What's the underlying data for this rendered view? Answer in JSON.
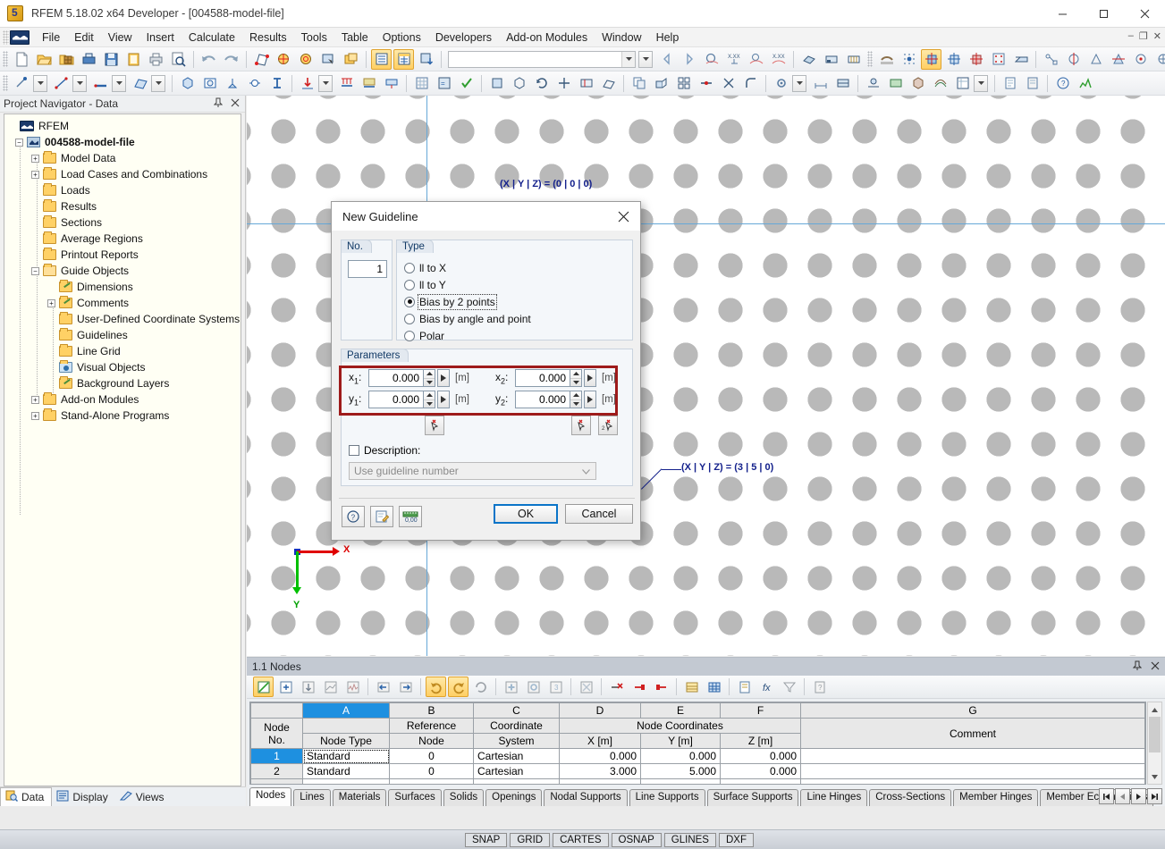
{
  "window": {
    "title": "RFEM 5.18.02 x64 Developer - [004588-model-file]",
    "minimize": "–",
    "maximize": "□",
    "close": "✕",
    "inner_minimize": "–",
    "inner_restore": "❐",
    "inner_close": "✕"
  },
  "menu": {
    "items": [
      {
        "label": "File",
        "accel": "F"
      },
      {
        "label": "Edit",
        "accel": "E"
      },
      {
        "label": "View",
        "accel": "V"
      },
      {
        "label": "Insert",
        "accel": "I"
      },
      {
        "label": "Calculate",
        "accel": "C"
      },
      {
        "label": "Results",
        "accel": "R"
      },
      {
        "label": "Tools",
        "accel": "T"
      },
      {
        "label": "Table",
        "accel": "b"
      },
      {
        "label": "Options",
        "accel": "O"
      },
      {
        "label": "Developers",
        "accel": ""
      },
      {
        "label": "Add-on Modules",
        "accel": "A"
      },
      {
        "label": "Window",
        "accel": "W"
      },
      {
        "label": "Help",
        "accel": "H"
      }
    ]
  },
  "toolbar": {
    "combo_value": "",
    "combo_placeholder": ""
  },
  "navigator": {
    "header": "Project Navigator - Data",
    "pin_icon": "pin-icon",
    "close_icon": "close-icon",
    "root": "RFEM",
    "model": "004588-model-file",
    "items": [
      {
        "label": "Model Data",
        "expander": "+",
        "indent": 1,
        "icon": "folder"
      },
      {
        "label": "Load Cases and Combinations",
        "expander": "+",
        "indent": 1,
        "icon": "folder"
      },
      {
        "label": "Loads",
        "expander": "",
        "indent": 1,
        "icon": "folder"
      },
      {
        "label": "Results",
        "expander": "",
        "indent": 1,
        "icon": "folder"
      },
      {
        "label": "Sections",
        "expander": "",
        "indent": 1,
        "icon": "folder"
      },
      {
        "label": "Average Regions",
        "expander": "",
        "indent": 1,
        "icon": "folder"
      },
      {
        "label": "Printout Reports",
        "expander": "",
        "indent": 1,
        "icon": "folder"
      },
      {
        "label": "Guide Objects",
        "expander": "-",
        "indent": 1,
        "icon": "folder-open"
      },
      {
        "label": "Dimensions",
        "expander": "",
        "indent": 2,
        "icon": "folder-pen"
      },
      {
        "label": "Comments",
        "expander": "+",
        "indent": 2,
        "icon": "folder-pen"
      },
      {
        "label": "User-Defined Coordinate Systems",
        "expander": "",
        "indent": 2,
        "icon": "folder"
      },
      {
        "label": "Guidelines",
        "expander": "",
        "indent": 2,
        "icon": "folder"
      },
      {
        "label": "Line Grid",
        "expander": "",
        "indent": 2,
        "icon": "folder"
      },
      {
        "label": "Visual Objects",
        "expander": "",
        "indent": 2,
        "icon": "folder-cam"
      },
      {
        "label": "Background Layers",
        "expander": "",
        "indent": 2,
        "icon": "folder-pen"
      },
      {
        "label": "Add-on Modules",
        "expander": "+",
        "indent": 1,
        "icon": "folder"
      },
      {
        "label": "Stand-Alone Programs",
        "expander": "+",
        "indent": 1,
        "icon": "folder"
      }
    ],
    "bottom_tabs": [
      {
        "label": "Data",
        "selected": true,
        "icon": "data-icon"
      },
      {
        "label": "Display",
        "selected": false,
        "icon": "display-icon"
      },
      {
        "label": "Views",
        "selected": false,
        "icon": "views-icon"
      }
    ]
  },
  "canvas": {
    "label_origin": "(X | Y | Z) = (0 | 0 | 0)",
    "label_point2": "(X | Y | Z) = (3 | 5 | 0)",
    "axis_x_label": "X",
    "axis_y_label": "Y"
  },
  "dialog": {
    "title": "New Guideline",
    "close_icon": "close-icon",
    "no_group": "No.",
    "no_value": "1",
    "type_group": "Type",
    "type_options": [
      {
        "label": "ll to X",
        "accel": "X",
        "selected": false
      },
      {
        "label": "ll to Y",
        "accel": "Y",
        "selected": false
      },
      {
        "label": "Bias by 2 points",
        "accel": "2",
        "selected": true
      },
      {
        "label": "Bias by angle and point",
        "accel": "a",
        "selected": false
      },
      {
        "label": "Polar",
        "accel": "P",
        "selected": false
      }
    ],
    "parameters_group": "Parameters",
    "fields": [
      {
        "name": "x1",
        "label": "x",
        "sub": "1",
        "value": "0.000",
        "unit": "[m]"
      },
      {
        "name": "x2",
        "label": "x",
        "sub": "2",
        "value": "0.000",
        "unit": "[m]"
      },
      {
        "name": "y1",
        "label": "y",
        "sub": "1",
        "value": "0.000",
        "unit": "[m]"
      },
      {
        "name": "y2",
        "label": "y",
        "sub": "2",
        "value": "0.000",
        "unit": "[m]"
      }
    ],
    "description_label": "Description:",
    "description_checked": false,
    "description_value": "Use guideline number",
    "help_icon": "help-icon",
    "edit_icon": "edit-icon",
    "units_icon": "units-icon",
    "ok_label": "OK",
    "cancel_label": "Cancel",
    "pick_icon_1": "pick-point-icon",
    "pick_icon_2": "pick-point-icon",
    "pick_icon_3": "pick-two-points-icon",
    "highlight_color": "#9e1b1b"
  },
  "table": {
    "title": "1.1 Nodes",
    "pin_icon": "pin-icon",
    "close_icon": "close-icon",
    "column_letters": [
      "",
      "A",
      "B",
      "C",
      "D",
      "E",
      "F",
      "G"
    ],
    "selected_column": "A",
    "group_header": "Node Coordinates",
    "headers": {
      "row_no_top": "Node",
      "row_no_bottom": "No.",
      "a_bottom": "Node Type",
      "b_top": "Reference",
      "b_bottom": "Node",
      "c_top": "Coordinate",
      "c_bottom": "System",
      "d": "X [m]",
      "e": "Y [m]",
      "f": "Z [m]",
      "g": "Comment"
    },
    "rows": [
      {
        "no": "1",
        "node_type": "Standard",
        "reference_node": "0",
        "coordinate_system": "Cartesian",
        "x": "0.000",
        "y": "0.000",
        "z": "0.000",
        "comment": "",
        "selected": true
      },
      {
        "no": "2",
        "node_type": "Standard",
        "reference_node": "0",
        "coordinate_system": "Cartesian",
        "x": "3.000",
        "y": "5.000",
        "z": "0.000",
        "comment": "",
        "selected": false
      }
    ],
    "tabs": [
      {
        "label": "Nodes",
        "selected": true
      },
      {
        "label": "Lines",
        "selected": false
      },
      {
        "label": "Materials",
        "selected": false
      },
      {
        "label": "Surfaces",
        "selected": false
      },
      {
        "label": "Solids",
        "selected": false
      },
      {
        "label": "Openings",
        "selected": false
      },
      {
        "label": "Nodal Supports",
        "selected": false
      },
      {
        "label": "Line Supports",
        "selected": false
      },
      {
        "label": "Surface Supports",
        "selected": false
      },
      {
        "label": "Line Hinges",
        "selected": false
      },
      {
        "label": "Cross-Sections",
        "selected": false
      },
      {
        "label": "Member Hinges",
        "selected": false
      },
      {
        "label": "Member Eccentricities",
        "selected": false
      }
    ],
    "nav_buttons": [
      "⏮",
      "◀",
      "▶",
      "⏭"
    ]
  },
  "statusbar": {
    "buttons": [
      "SNAP",
      "GRID",
      "CARTES",
      "OSNAP",
      "GLINES",
      "DXF"
    ]
  }
}
